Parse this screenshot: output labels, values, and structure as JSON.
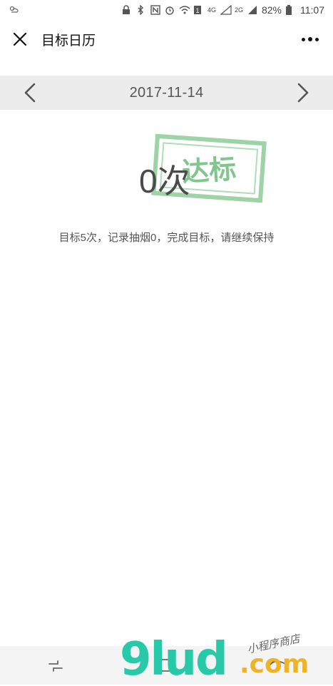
{
  "status_bar": {
    "battery_text": "82%",
    "time": "11:07",
    "network_4g": "4G",
    "network_2g": "2G"
  },
  "header": {
    "title": "目标日历",
    "close_icon": "close-icon",
    "more_icon": "more-icon"
  },
  "date_nav": {
    "date": "2017-11-14",
    "prev_icon": "chevron-left-icon",
    "next_icon": "chevron-right-icon"
  },
  "summary": {
    "count_text": "0次",
    "stamp_text": "达标",
    "stamp_color": "#5fb36f",
    "message": "目标5次，记录抽烟0，完成目标，请继续保持"
  },
  "watermark": {
    "main": "9lud",
    "domain": ".com",
    "sub": "小程序商店",
    "main_color": "#27c9a8",
    "domain_color": "#f0b323"
  },
  "system_nav": {
    "recent_icon": "recent-apps-icon",
    "home_icon": "home-icon",
    "back_icon": "back-icon"
  }
}
